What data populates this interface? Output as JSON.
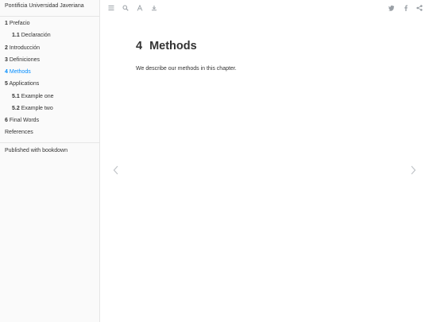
{
  "sidebar": {
    "site_title": "Pontificia Universidad Javeriana",
    "toc": [
      {
        "num": "1",
        "label": "Prefacio",
        "level": 1,
        "active": false
      },
      {
        "num": "1.1",
        "label": "Declaración",
        "level": 2,
        "active": false
      },
      {
        "num": "2",
        "label": "Introducción",
        "level": 1,
        "active": false
      },
      {
        "num": "3",
        "label": "Definiciones",
        "level": 1,
        "active": false
      },
      {
        "num": "4",
        "label": "Methods",
        "level": 1,
        "active": true
      },
      {
        "num": "5",
        "label": "Applications",
        "level": 1,
        "active": false
      },
      {
        "num": "5.1",
        "label": "Example one",
        "level": 2,
        "active": false
      },
      {
        "num": "5.2",
        "label": "Example two",
        "level": 2,
        "active": false
      },
      {
        "num": "6",
        "label": "Final Words",
        "level": 1,
        "active": false
      },
      {
        "num": "",
        "label": "References",
        "level": 1,
        "active": false
      }
    ],
    "published": "Published with bookdown"
  },
  "header": {
    "left_icons": [
      "menu-icon",
      "search-icon",
      "font-settings-icon",
      "edit-icon"
    ],
    "right_icons": [
      "twitter-icon",
      "facebook-icon",
      "share-icon"
    ]
  },
  "main": {
    "chapter_number": "4",
    "chapter_title": "Methods",
    "paragraph": "We describe our methods in this chapter."
  },
  "colors": {
    "accent": "#008cff",
    "sidebar_bg": "#fafafa",
    "icon": "#9aa0a6"
  }
}
